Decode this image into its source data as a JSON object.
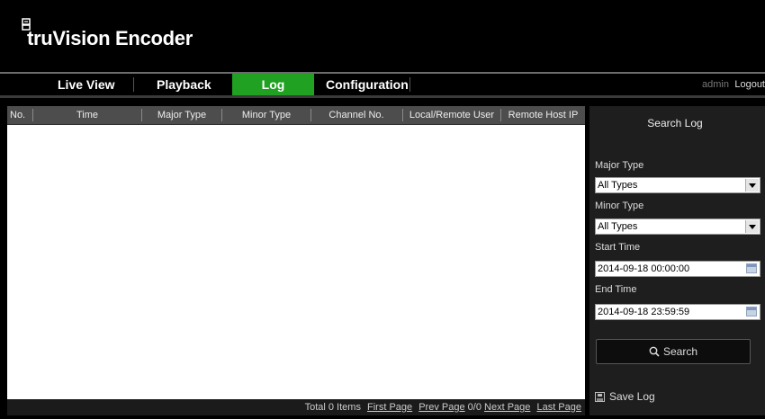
{
  "app": {
    "title": "truVision Encoder"
  },
  "nav": {
    "items": [
      {
        "label": "Live View",
        "active": false
      },
      {
        "label": "Playback",
        "active": false
      },
      {
        "label": "Log",
        "active": true
      },
      {
        "label": "Configuration",
        "active": false
      }
    ],
    "user": "admin",
    "logout": "Logout",
    "active_color": "#21a121"
  },
  "table": {
    "columns": [
      "No.",
      "Time",
      "Major Type",
      "Minor Type",
      "Channel No.",
      "Local/Remote User",
      "Remote Host IP"
    ],
    "rows": [],
    "footer": {
      "total": "Total 0 Items",
      "first": "First Page",
      "prev": "Prev Page",
      "pages": "0/0",
      "next": "Next Page",
      "last": "Last Page"
    }
  },
  "search": {
    "title": "Search Log",
    "major_label": "Major Type",
    "major_value": "All Types",
    "minor_label": "Minor Type",
    "minor_value": "All Types",
    "start_label": "Start Time",
    "start_value": "2014-09-18 00:00:00",
    "end_label": "End Time",
    "end_value": "2014-09-18 23:59:59",
    "search_button": "Search",
    "save_log": "Save Log"
  }
}
